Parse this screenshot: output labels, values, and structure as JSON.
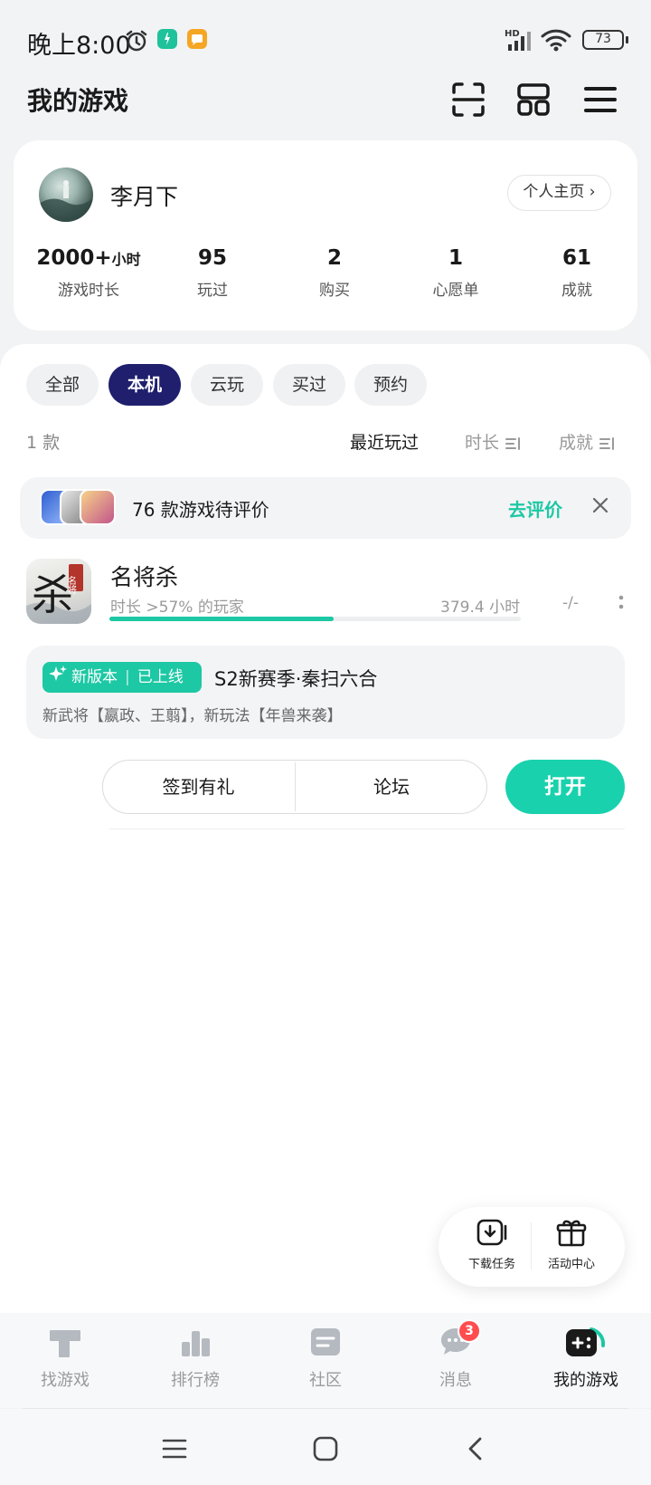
{
  "status_bar": {
    "time": "晚上8:00",
    "battery": "73",
    "hd_label": "HD"
  },
  "header": {
    "title": "我的游戏"
  },
  "profile": {
    "username": "李月下",
    "homepage_label": "个人主页",
    "stats": [
      {
        "value": "2000+",
        "unit": "小时",
        "label": "游戏时长"
      },
      {
        "value": "95",
        "unit": "",
        "label": "玩过"
      },
      {
        "value": "2",
        "unit": "",
        "label": "购买"
      },
      {
        "value": "1",
        "unit": "",
        "label": "心愿单"
      },
      {
        "value": "61",
        "unit": "",
        "label": "成就"
      }
    ]
  },
  "tabs": [
    {
      "label": "全部",
      "active": false
    },
    {
      "label": "本机",
      "active": true
    },
    {
      "label": "云玩",
      "active": false
    },
    {
      "label": "买过",
      "active": false
    },
    {
      "label": "预约",
      "active": false
    }
  ],
  "list_meta": {
    "count": "1 款",
    "sort_options": [
      {
        "label": "最近玩过",
        "active": true
      },
      {
        "label": "时长",
        "active": false
      },
      {
        "label": "成就",
        "active": false
      }
    ]
  },
  "review_banner": {
    "text": "76 款游戏待评价",
    "action": "去评价"
  },
  "game": {
    "name": "名将杀",
    "subtitle": "时长 >57% 的玩家",
    "hours": "379.4 小时",
    "score": "-/-",
    "progress_fraction": 0.545,
    "icon_text": "杀",
    "icon_stamp": "名将"
  },
  "news": {
    "badge_left": "新版本",
    "badge_right": "已上线",
    "title": "S2新赛季·秦扫六合",
    "desc": "新武将【嬴政、王翦】，新玩法【年兽来袭】"
  },
  "actions": {
    "checkin": "签到有礼",
    "forum": "论坛",
    "open": "打开"
  },
  "floating": {
    "download": "下载任务",
    "activity": "活动中心"
  },
  "bottom_nav": {
    "items": [
      {
        "label": "找游戏",
        "icon": "find-game-icon"
      },
      {
        "label": "排行榜",
        "icon": "ranking-icon"
      },
      {
        "label": "社区",
        "icon": "community-icon"
      },
      {
        "label": "消息",
        "icon": "message-icon"
      },
      {
        "label": "我的游戏",
        "icon": "gamepad-icon",
        "active": true
      }
    ],
    "message_badge": "3"
  },
  "colors": {
    "accent": "#1dc8a4",
    "active_tab": "#1f1f6e",
    "badge": "#ff4d4f"
  }
}
